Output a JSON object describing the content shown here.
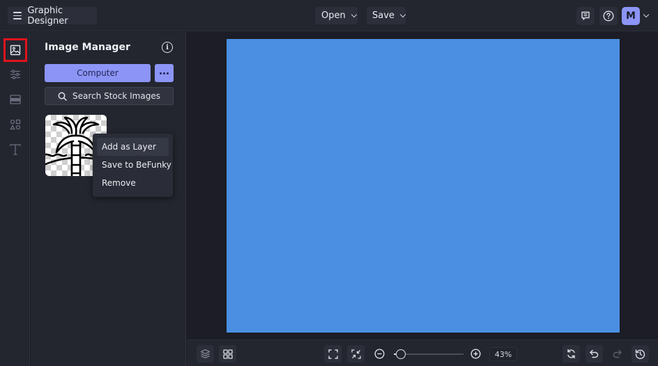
{
  "topbar": {
    "app_title": "Graphic Designer",
    "open_label": "Open",
    "save_label": "Save",
    "avatar_initial": "M"
  },
  "rail": {
    "items": [
      {
        "name": "image-manager",
        "icon": "image-icon",
        "active": true
      },
      {
        "name": "adjustments",
        "icon": "sliders-icon",
        "active": false
      },
      {
        "name": "layouts",
        "icon": "layout-icon",
        "active": false
      },
      {
        "name": "graphics",
        "icon": "shapes-icon",
        "active": false
      },
      {
        "name": "text",
        "icon": "text-icon",
        "active": false
      }
    ]
  },
  "panel": {
    "title": "Image Manager",
    "computer_label": "Computer",
    "search_label": "Search Stock Images",
    "thumbnails": [
      {
        "subject": "palm tree beach line art"
      }
    ]
  },
  "context_menu": {
    "items": [
      {
        "label": "Add as Layer",
        "highlighted": true
      },
      {
        "label": "Save to BeFunky",
        "highlighted": false
      },
      {
        "label": "Remove",
        "highlighted": false
      }
    ]
  },
  "canvas": {
    "background_color": "#4a8fe2"
  },
  "bottombar": {
    "zoom_percent_label": "43%",
    "zoom_slider_fraction": 0.1
  },
  "colors": {
    "accent": "#8c95f6",
    "active_highlight": "#e0141b",
    "app_bg": "#23252f",
    "workspace_bg": "#1c1d26"
  }
}
